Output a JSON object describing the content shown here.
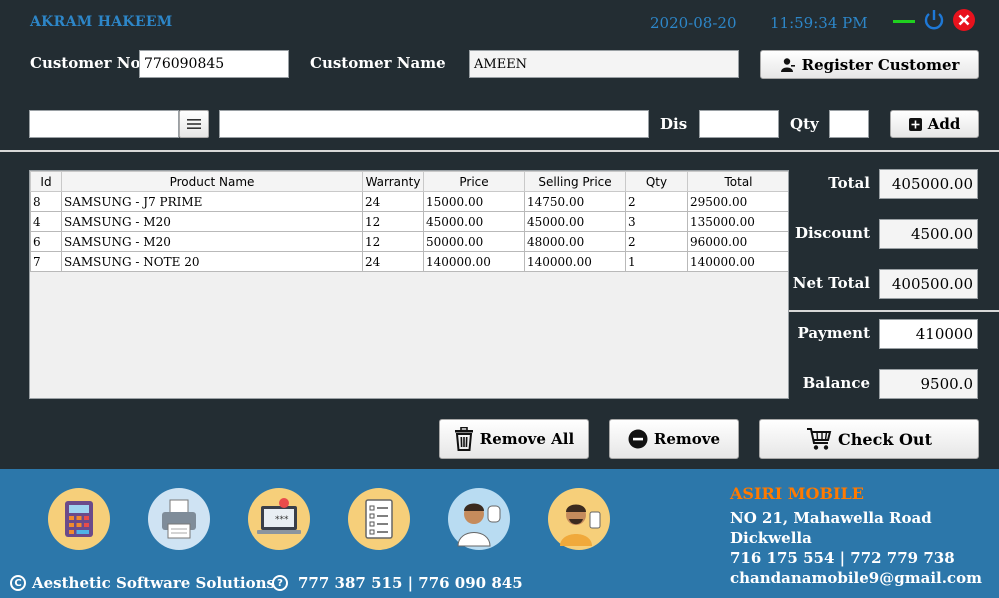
{
  "header": {
    "user_name": "AKRAM HAKEEM",
    "date": "2020-08-20",
    "time": "11:59:34 PM"
  },
  "customer": {
    "no_label": "Customer No",
    "no_value": "776090845",
    "name_label": "Customer Name",
    "name_value": "AMEEN",
    "register_label": "Register Customer"
  },
  "product_entry": {
    "dis_label": "Dis",
    "qty_label": "Qty",
    "add_label": "Add",
    "code_value": "",
    "name_value": "",
    "dis_value": "",
    "qty_value": ""
  },
  "table": {
    "columns": [
      "Id",
      "Product Name",
      "Warranty",
      "Price",
      "Selling Price",
      "Qty",
      "Total"
    ],
    "rows": [
      [
        "8",
        "SAMSUNG - J7 PRIME",
        "24",
        "15000.00",
        "14750.00",
        "2",
        "29500.00"
      ],
      [
        "4",
        "SAMSUNG - M20",
        "12",
        "45000.00",
        "45000.00",
        "3",
        "135000.00"
      ],
      [
        "6",
        "SAMSUNG - M20",
        "12",
        "50000.00",
        "48000.00",
        "2",
        "96000.00"
      ],
      [
        "7",
        "SAMSUNG - NOTE 20",
        "24",
        "140000.00",
        "140000.00",
        "1",
        "140000.00"
      ]
    ]
  },
  "summary": {
    "total_label": "Total",
    "total_value": "405000.00",
    "discount_label": "Discount",
    "discount_value": "4500.00",
    "net_label": "Net Total",
    "net_value": "400500.00",
    "payment_label": "Payment",
    "payment_value": "410000",
    "balance_label": "Balance",
    "balance_value": "9500.0"
  },
  "actions": {
    "remove_all_label": "Remove All",
    "remove_label": "Remove",
    "checkout_label": "Check Out"
  },
  "footer": {
    "company_name": "ASIRI MOBILE",
    "address_line1": "NO 21, Mahawella Road",
    "address_line2": "Dickwella",
    "phones": "716 175 554 | 772 779 738",
    "email": "chandanamobile9@gmail.com",
    "credit": "Aesthetic Software Solutions",
    "help_phones": "777 387 515 | 776 090 845",
    "icons": [
      "calculator-icon",
      "printer-icon",
      "laptop-password-icon",
      "checklist-icon",
      "customer-support-icon",
      "user-profile-icon"
    ]
  },
  "colors": {
    "background": "#232d33",
    "accent_blue": "#2d86c8",
    "footer_blue": "#2c77aa",
    "brand_orange": "#ff7a00",
    "close_red": "#e8121d",
    "minimize_green": "#1fd01f"
  }
}
